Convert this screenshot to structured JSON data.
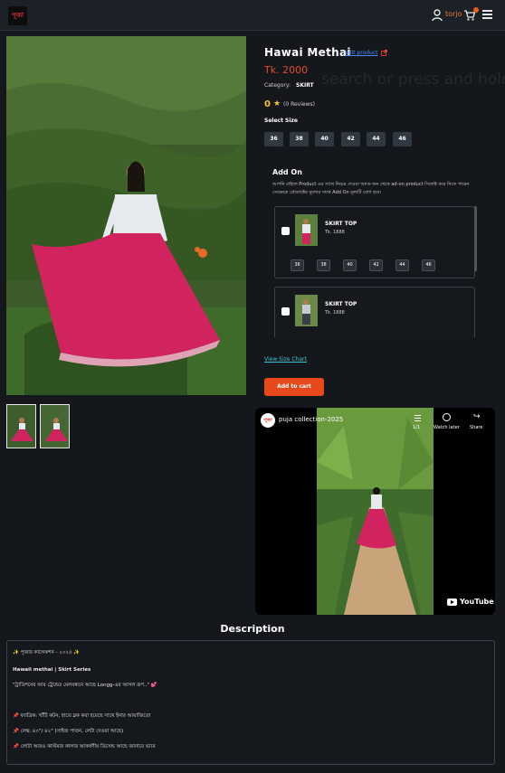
{
  "nav": {
    "logo_text": "পূজা",
    "user_name": "torjo",
    "icons": [
      "user-icon",
      "cart-icon",
      "menu-icon"
    ]
  },
  "product": {
    "title": "Hawai Methai",
    "edit_link": "edit product",
    "price": "Tk. 2000",
    "watermark": "search or press and hold",
    "category_label": "Category:",
    "category_value": "SKIRT",
    "rating": "0",
    "reviews": "(0 Reviews)",
    "select_size_label": "Select Size",
    "sizes": [
      "36",
      "38",
      "40",
      "42",
      "44",
      "46"
    ]
  },
  "addon": {
    "title": "Add On",
    "description": "আপনি চাইলে Product এর সাথে নিচের দেওয়া অ্যাড-অন থেকে ad-on product সিলেক্ট করে নিতে পারেন সেক্ষেত্রে প্রোডাক্টের মূল্যের সাথে Add On মূল্যটি যোগ হবে।",
    "items": [
      {
        "name": "SKIRT TOP",
        "price": "Tk. 1888",
        "sizes": [
          "36",
          "38",
          "40",
          "42",
          "44",
          "46"
        ]
      },
      {
        "name": "SKIRT TOP",
        "price": "Tk. 1888"
      }
    ]
  },
  "size_chart_link": "View Size Chart",
  "add_to_cart": "Add to cart",
  "video": {
    "channel_logo": "পূজা",
    "title": "puja collection-2025",
    "count": "1/1",
    "watch_later": "Watch later",
    "share": "Share",
    "brand": "YouTube"
  },
  "description": {
    "heading": "Description",
    "lines": [
      "✨ পূজার কালেকশন - ২০২৫ ✨",
      "Hawaii methai | Skirt Series",
      "\"ট্রাডিশনের আর ট্রেন্ডের মেলবন্ধনে আছে Longg-এর আসল রূপ..\" 💕",
      "📌 ফ্যাব্রিক: খাঁটি কটন, হাতে ব্লক করা হয়েছে সাথে ইনার আয়াজিতো",
      "📌 লেন্থ: ৪০\"/ ৪২\" (সাইজ পাতন, লেটা দেওয়া আছে)",
      "📌 লোটা আরও কাস্টমার কালার আকর্ষণীয় ডিসেন্ড আছে জানাবে ভাবে"
    ]
  },
  "colors": {
    "accent": "#e8481c",
    "price": "#e8462e",
    "star": "#f4c430",
    "link": "#43c2d1",
    "background": "#14181c"
  }
}
